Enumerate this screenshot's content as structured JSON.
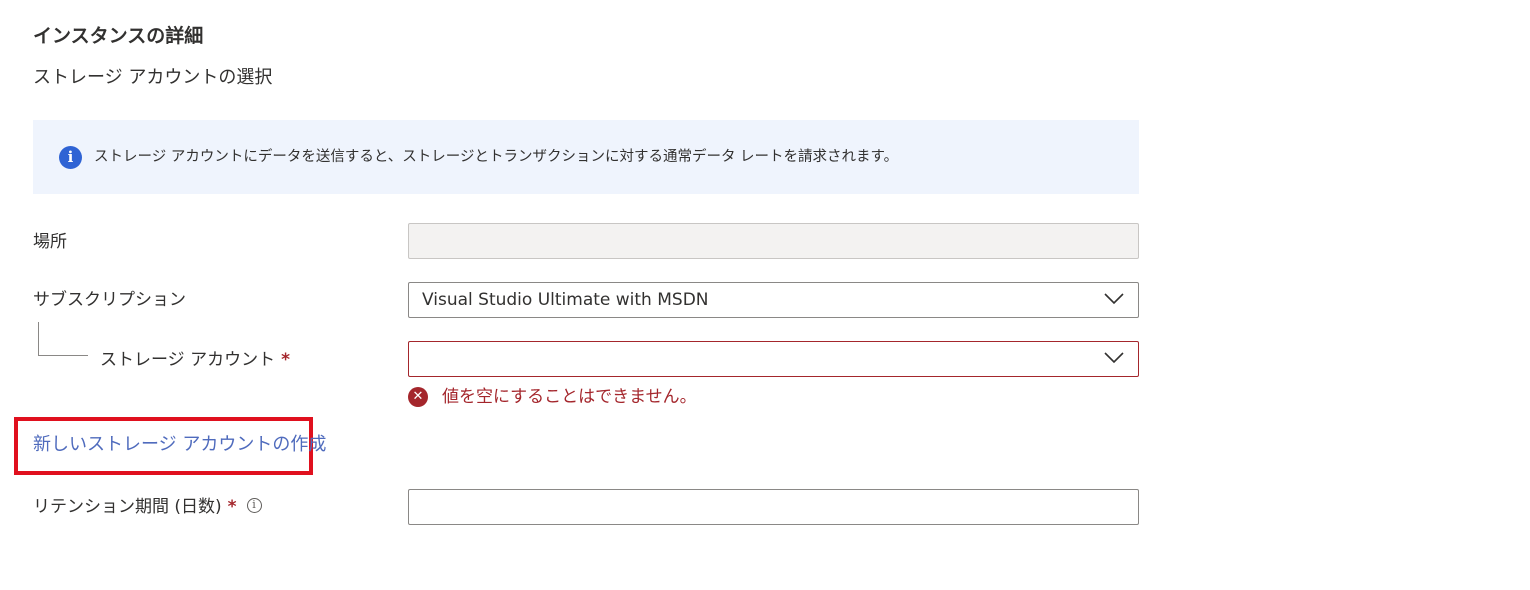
{
  "section": {
    "title": "インスタンスの詳細",
    "subtitle": "ストレージ アカウントの選択"
  },
  "info_banner": {
    "icon": "info-icon",
    "text": "ストレージ アカウントにデータを送信すると、ストレージとトランザクションに対する通常データ レートを請求されます。"
  },
  "form": {
    "location": {
      "label": "場所",
      "value": ""
    },
    "subscription": {
      "label": "サブスクリプション",
      "value": "Visual Studio Ultimate with MSDN"
    },
    "storage_account": {
      "label": "ストレージ アカウント",
      "required": "*",
      "value": "",
      "error": "値を空にすることはできません。"
    },
    "create_link": "新しいストレージ アカウントの作成",
    "retention": {
      "label": "リテンション期間 (日数)",
      "required": "*",
      "info_glyph": "i",
      "value": ""
    }
  },
  "colors": {
    "error": "#a4262c",
    "link": "#4f6bbd",
    "highlight": "#e0101e",
    "info_blue": "#2f63d4",
    "banner_bg": "#eff4fd"
  }
}
